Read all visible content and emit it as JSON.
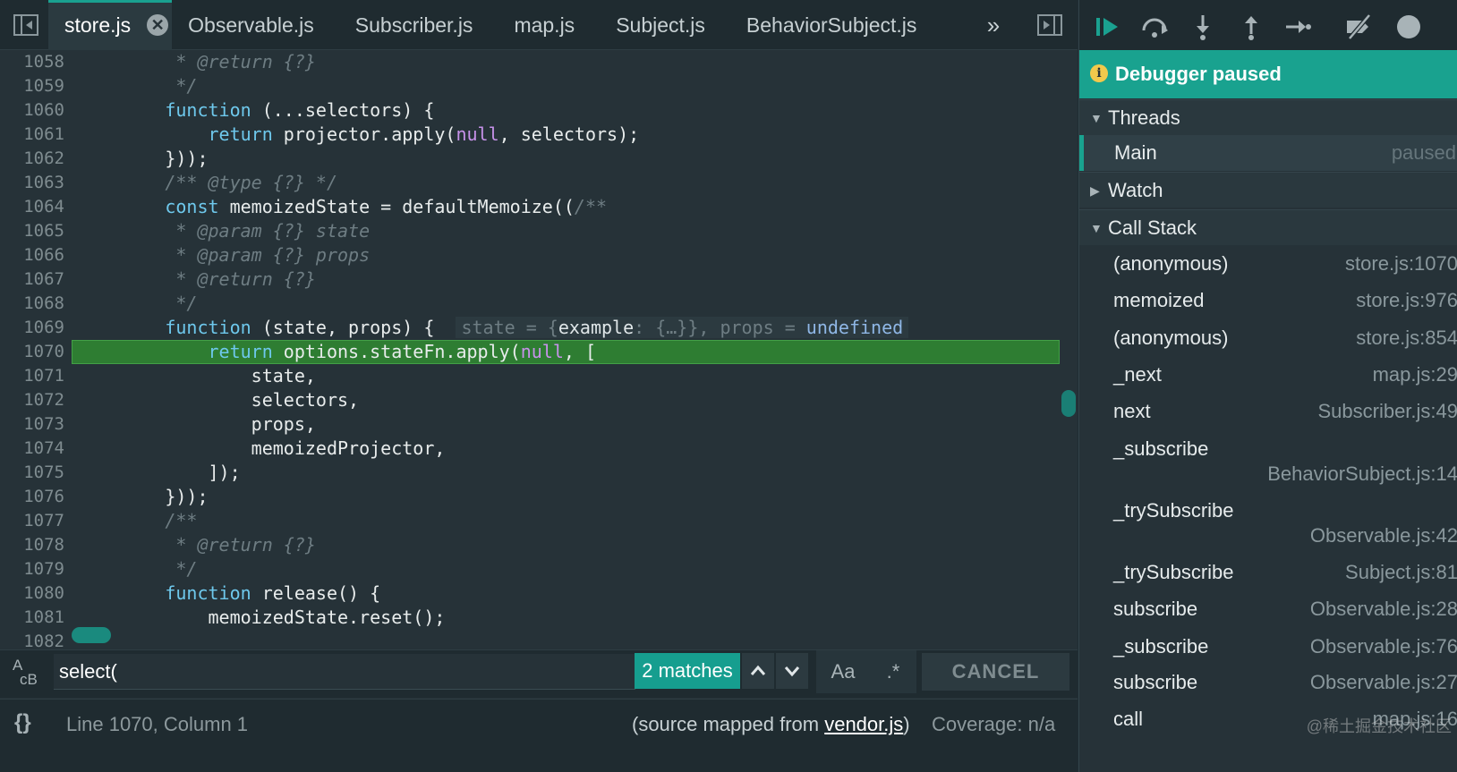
{
  "tabs": [
    {
      "label": "store.js",
      "active": true
    },
    {
      "label": "Observable.js"
    },
    {
      "label": "Subscriber.js"
    },
    {
      "label": "map.js"
    },
    {
      "label": "Subject.js"
    },
    {
      "label": "BehaviorSubject.js"
    }
  ],
  "tab_overflow_glyph": "»",
  "tab_close_glyph": "✕",
  "code_lines": [
    {
      "n": "1058",
      "text": "         * @return {?}"
    },
    {
      "n": "1059",
      "text": "         */"
    },
    {
      "n": "1060",
      "text": "        function (...selectors) {"
    },
    {
      "n": "1061",
      "text": "            return projector.apply(null, selectors);"
    },
    {
      "n": "1062",
      "text": "        }));"
    },
    {
      "n": "1063",
      "text": "        /** @type {?} */"
    },
    {
      "n": "1064",
      "text": "        const memoizedState = defaultMemoize((/**"
    },
    {
      "n": "1065",
      "text": "         * @param {?} state"
    },
    {
      "n": "1066",
      "text": "         * @param {?} props"
    },
    {
      "n": "1067",
      "text": "         * @return {?}"
    },
    {
      "n": "1068",
      "text": "         */"
    },
    {
      "n": "1069",
      "text": "        function (state, props) {"
    },
    {
      "n": "1070",
      "text": "            return options.stateFn.apply(null, ["
    },
    {
      "n": "1071",
      "text": "                state,"
    },
    {
      "n": "1072",
      "text": "                selectors,"
    },
    {
      "n": "1073",
      "text": "                props,"
    },
    {
      "n": "1074",
      "text": "                memoizedProjector,"
    },
    {
      "n": "1075",
      "text": "            ]);"
    },
    {
      "n": "1076",
      "text": "        }));"
    },
    {
      "n": "1077",
      "text": "        /**"
    },
    {
      "n": "1078",
      "text": "         * @return {?}"
    },
    {
      "n": "1079",
      "text": "         */"
    },
    {
      "n": "1080",
      "text": "        function release() {"
    },
    {
      "n": "1081",
      "text": "            memoizedState.reset();"
    },
    {
      "n": "1082",
      "text": ""
    }
  ],
  "inline_value": {
    "state_label": "state = {",
    "state_key": "example",
    "state_rest": ": {…}}, props = ",
    "props_value": "undefined"
  },
  "search": {
    "value": "select(",
    "match_count": "2 matches",
    "case_label": "Aa",
    "regex_label": ".*",
    "cancel_label": "CANCEL",
    "icon_top": "A",
    "icon_bottom": "ᴄB"
  },
  "status": {
    "format_glyph": "{}",
    "cursor": "Line 1070, Column 1",
    "source_prefix": "(source mapped from ",
    "source_file": "vendor.js",
    "source_suffix": ")",
    "coverage": "Coverage: n/a"
  },
  "debugger": {
    "banner": "Debugger paused",
    "banner_icon": "i",
    "threads_label": "Threads",
    "thread_name": "Main",
    "thread_state": "paused",
    "watch_label": "Watch",
    "callstack_label": "Call Stack",
    "frames": [
      {
        "name": "(anonymous)",
        "loc": "store.js:1070"
      },
      {
        "name": "memoized",
        "loc": "store.js:976"
      },
      {
        "name": "(anonymous)",
        "loc": "store.js:854"
      },
      {
        "name": "_next",
        "loc": "map.js:29"
      },
      {
        "name": "next",
        "loc": "Subscriber.js:49"
      },
      {
        "name": "_subscribe",
        "loc": "BehaviorSubject.js:14"
      },
      {
        "name": "_trySubscribe",
        "loc": "Observable.js:42"
      },
      {
        "name": "_trySubscribe",
        "loc": "Subject.js:81"
      },
      {
        "name": "subscribe",
        "loc": "Observable.js:28"
      },
      {
        "name": "_subscribe",
        "loc": "Observable.js:76"
      },
      {
        "name": "subscribe",
        "loc": "Observable.js:27"
      },
      {
        "name": "call",
        "loc": "map.js:16"
      }
    ]
  },
  "watermark": "@稀土掘金技术社区"
}
